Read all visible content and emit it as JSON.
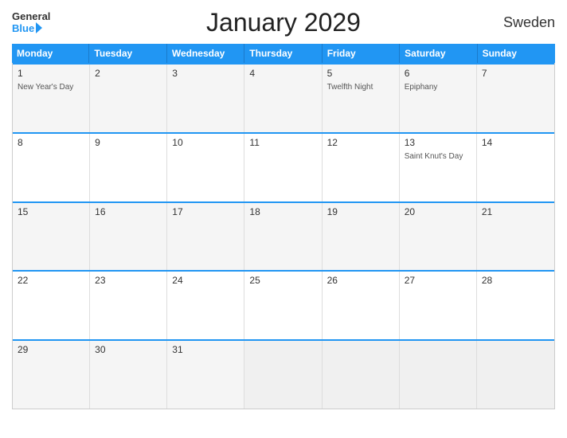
{
  "header": {
    "title": "January 2029",
    "country": "Sweden",
    "logo_general": "General",
    "logo_blue": "Blue"
  },
  "days": [
    "Monday",
    "Tuesday",
    "Wednesday",
    "Thursday",
    "Friday",
    "Saturday",
    "Sunday"
  ],
  "weeks": [
    [
      {
        "day": "1",
        "event": "New Year's Day"
      },
      {
        "day": "2",
        "event": ""
      },
      {
        "day": "3",
        "event": ""
      },
      {
        "day": "4",
        "event": ""
      },
      {
        "day": "5",
        "event": "Twelfth Night"
      },
      {
        "day": "6",
        "event": "Epiphany"
      },
      {
        "day": "7",
        "event": ""
      }
    ],
    [
      {
        "day": "8",
        "event": ""
      },
      {
        "day": "9",
        "event": ""
      },
      {
        "day": "10",
        "event": ""
      },
      {
        "day": "11",
        "event": ""
      },
      {
        "day": "12",
        "event": ""
      },
      {
        "day": "13",
        "event": "Saint Knut's Day"
      },
      {
        "day": "14",
        "event": ""
      }
    ],
    [
      {
        "day": "15",
        "event": ""
      },
      {
        "day": "16",
        "event": ""
      },
      {
        "day": "17",
        "event": ""
      },
      {
        "day": "18",
        "event": ""
      },
      {
        "day": "19",
        "event": ""
      },
      {
        "day": "20",
        "event": ""
      },
      {
        "day": "21",
        "event": ""
      }
    ],
    [
      {
        "day": "22",
        "event": ""
      },
      {
        "day": "23",
        "event": ""
      },
      {
        "day": "24",
        "event": ""
      },
      {
        "day": "25",
        "event": ""
      },
      {
        "day": "26",
        "event": ""
      },
      {
        "day": "27",
        "event": ""
      },
      {
        "day": "28",
        "event": ""
      }
    ],
    [
      {
        "day": "29",
        "event": ""
      },
      {
        "day": "30",
        "event": ""
      },
      {
        "day": "31",
        "event": ""
      },
      {
        "day": "",
        "event": ""
      },
      {
        "day": "",
        "event": ""
      },
      {
        "day": "",
        "event": ""
      },
      {
        "day": "",
        "event": ""
      }
    ]
  ]
}
